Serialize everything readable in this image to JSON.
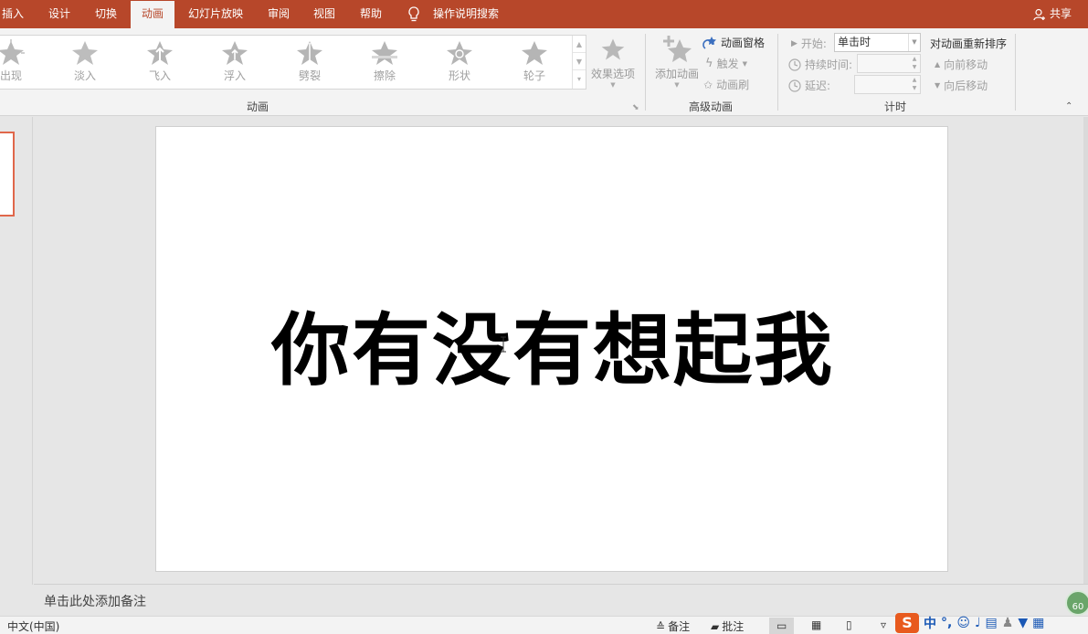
{
  "tabs": [
    "插入",
    "设计",
    "切换",
    "动画",
    "幻灯片放映",
    "审阅",
    "视图",
    "帮助"
  ],
  "active_tab": "动画",
  "tell_me": "操作说明搜索",
  "share": "共享",
  "animations": {
    "items": [
      "出现",
      "淡入",
      "飞入",
      "浮入",
      "劈裂",
      "擦除",
      "形状",
      "轮子"
    ],
    "effect_options": "效果选项",
    "group_label": "动画"
  },
  "advanced": {
    "add_animation": "添加动画",
    "animation_pane": "动画窗格",
    "trigger": "触发",
    "animation_painter": "动画刷",
    "group_label": "高级动画"
  },
  "timing": {
    "start_label": "开始:",
    "start_value": "单击时",
    "duration_label": "持续时间:",
    "delay_label": "延迟:",
    "reorder_title": "对动画重新排序",
    "move_earlier": "向前移动",
    "move_later": "向后移动",
    "group_label": "计时"
  },
  "slide": {
    "title": "你有没有想起我"
  },
  "notes_placeholder": "单击此处添加备注",
  "status": {
    "language": "中文(中国)",
    "notes": "备注",
    "comments": "批注",
    "badge": "60"
  },
  "ime": {
    "logo": "S",
    "mode": "中",
    "punct": "°,"
  },
  "colors": {
    "accent": "#b7472a",
    "thumb_border": "#e0674a"
  }
}
